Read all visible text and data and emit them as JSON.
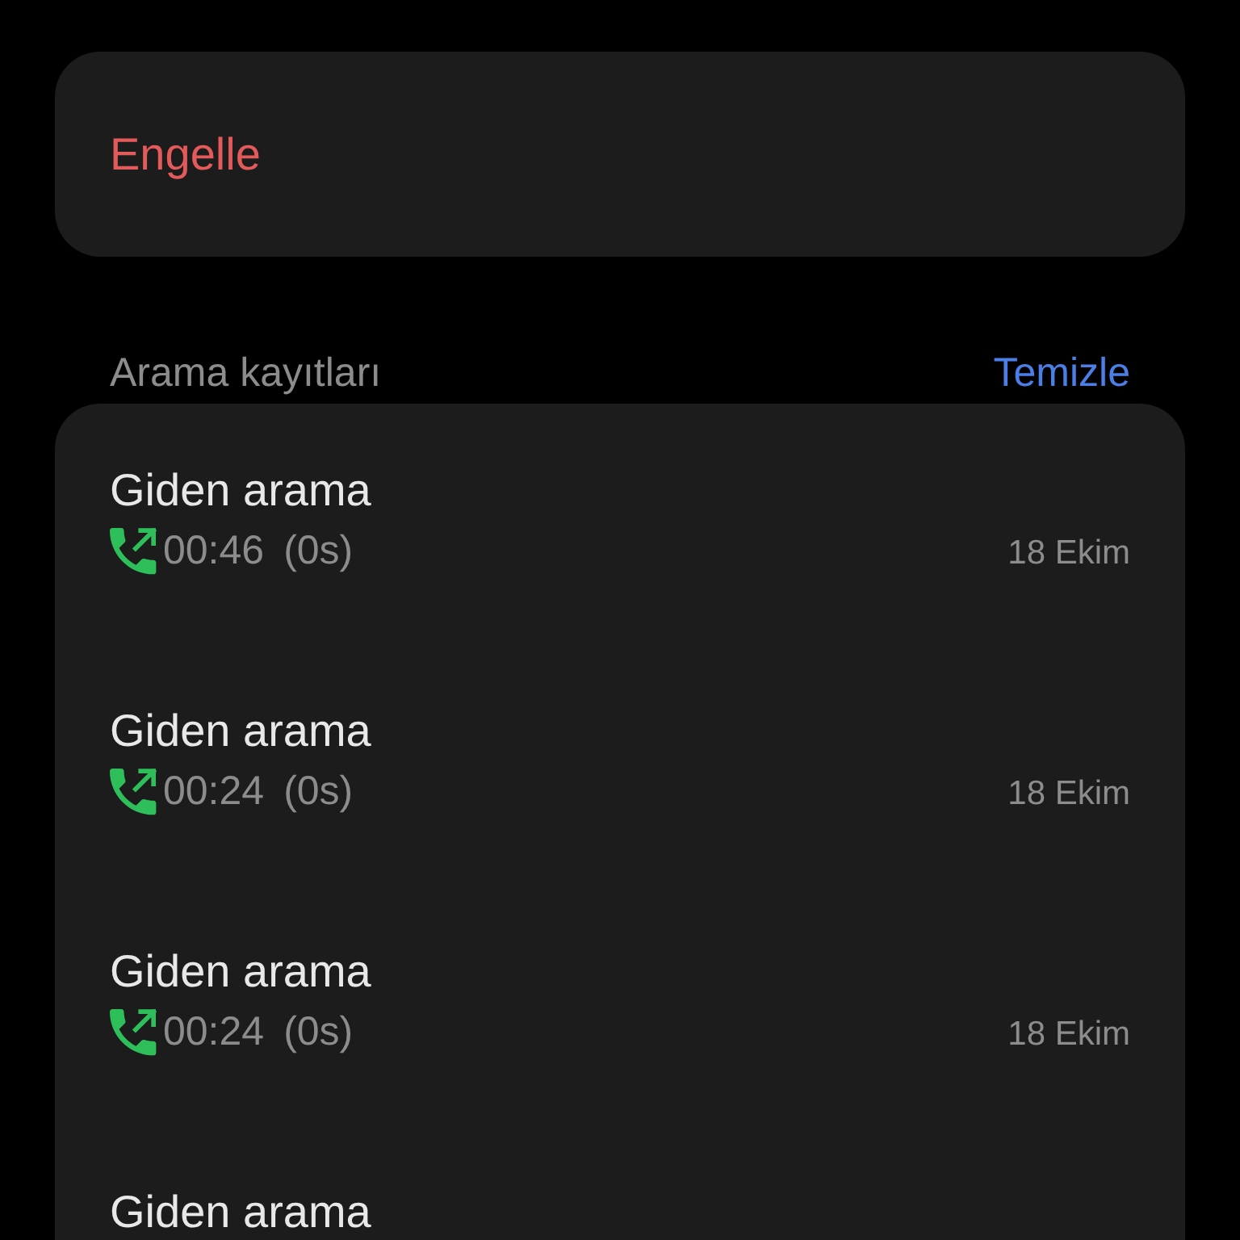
{
  "block_button": {
    "label": "Engelle"
  },
  "call_log": {
    "title": "Arama kayıtları",
    "clear_label": "Temizle",
    "entries": [
      {
        "kind": "outgoing",
        "title": "Giden arama",
        "time": "00:46",
        "duration": "(0s)",
        "date": "18 Ekim"
      },
      {
        "kind": "outgoing",
        "title": "Giden arama",
        "time": "00:24",
        "duration": "(0s)",
        "date": "18 Ekim"
      },
      {
        "kind": "outgoing",
        "title": "Giden arama",
        "time": "00:24",
        "duration": "(0s)",
        "date": "18 Ekim"
      },
      {
        "title": "Giden arama"
      }
    ]
  }
}
